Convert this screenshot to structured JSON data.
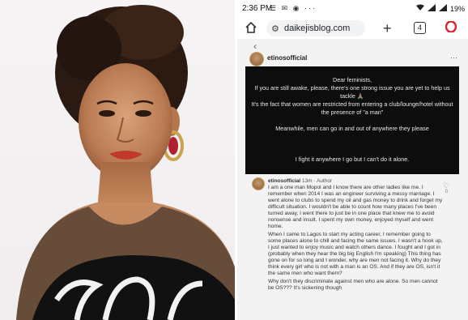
{
  "status_bar": {
    "time": "2:36 PM",
    "icons": "☰ ✉ ◉ ···",
    "battery": "19%"
  },
  "browser": {
    "url": "daikejisblog.com",
    "tab_count": "4",
    "plus": "+"
  },
  "post": {
    "username": "etinosofficial",
    "quote": {
      "greeting": "Dear feminists,",
      "line1": "If you are still awake, please, there's one strong issue you are yet to help us tackle 🙏🏽",
      "line2": "It's the fact that women are restricted from entering a club/lounge/hotel without the presence of \"a man\"",
      "line3": "Meanwhile, men can go in and out of anywhere they please",
      "line4": "I fight it anywhere I go but I can't do it alone."
    },
    "comment": {
      "username": "etinosofficial",
      "time": "13m",
      "meta_suffix": "· Author",
      "likes": "0",
      "paragraphs": [
        "I am a one man Mopol and I know there are other ladies like me. I remember when 2014 I was an engineer surviving a messy marriage. I went alone to clubs to spend my oil and gas money to drink and forget my difficult situation. I wouldn't be able to count how many places I've been turned away, I went there to just be in one place that knew me to avoid nonsense and insult. I spent my own money, enjoyed myself and went home.",
        "When I came to Lagos to start my acting career, I remember going to some places alone to chill and facing the same issues. I wasn't a hook up, I just wanted to enjoy music and watch others dance. I fought and I got in (probably when they hear the big big English I'm speaking) This thing has gone on for so long and I wonder, why are men not facing it. Why do they think every girl who is not with a man is an OS. And if they are OS, isn't it the same men who want them?",
        "Why don't they discriminate against men who are alone. So men cannot be OS??? It's sickening though"
      ]
    }
  }
}
